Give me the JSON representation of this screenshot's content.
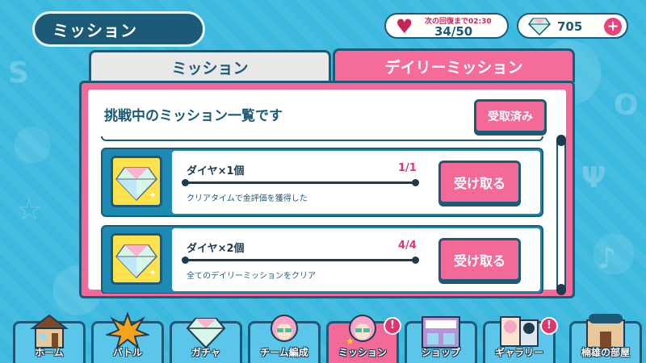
{
  "header": {
    "title": "ミッション",
    "stamina": {
      "recover_label": "次の回復まで02:30",
      "count": "34/50"
    },
    "diamonds": {
      "count": "705"
    }
  },
  "tabs": [
    {
      "label": "ミッション",
      "active": false
    },
    {
      "label": "デイリーミッション",
      "active": true
    }
  ],
  "panel": {
    "heading": "挑戦中のミッション一覧です",
    "received_button": "受取済み",
    "missions": [
      {
        "title": "ダイヤ×1個",
        "progress": "1/1",
        "description": "クリアタイムで金評価を獲得した",
        "button": "受け取る",
        "icon": "diamond-icon",
        "complete_fraction": 1.0
      },
      {
        "title": "ダイヤ×2個",
        "progress": "4/4",
        "description": "全てのデイリーミッションをクリア",
        "button": "受け取る",
        "icon": "diamond-icon",
        "complete_fraction": 1.0
      }
    ]
  },
  "nav": [
    {
      "label": "ホーム",
      "icon": "house-icon",
      "active": false,
      "badge": ""
    },
    {
      "label": "バトル",
      "icon": "battle-burst-icon",
      "active": false,
      "badge": ""
    },
    {
      "label": "ガチャ",
      "icon": "gacha-diamond-icon",
      "active": false,
      "badge": ""
    },
    {
      "label": "チーム編成",
      "icon": "team-character-icon",
      "active": false,
      "badge": ""
    },
    {
      "label": "ミッション",
      "icon": "mission-character-icon",
      "active": true,
      "badge": "!"
    },
    {
      "label": "ショップ",
      "icon": "shop-icon",
      "active": false,
      "badge": ""
    },
    {
      "label": "ギャラリー",
      "icon": "gallery-icon",
      "active": false,
      "badge": "!"
    },
    {
      "label": "楠雄の部屋",
      "icon": "room-icon",
      "active": false,
      "badge": ""
    }
  ],
  "shop_sign": "魔美",
  "room_sign": "くすおのへや",
  "colors": {
    "background": "#3cb9de",
    "accent_pink": "#f36a98",
    "navy": "#1d5a78",
    "progress_red": "#e3336d"
  }
}
